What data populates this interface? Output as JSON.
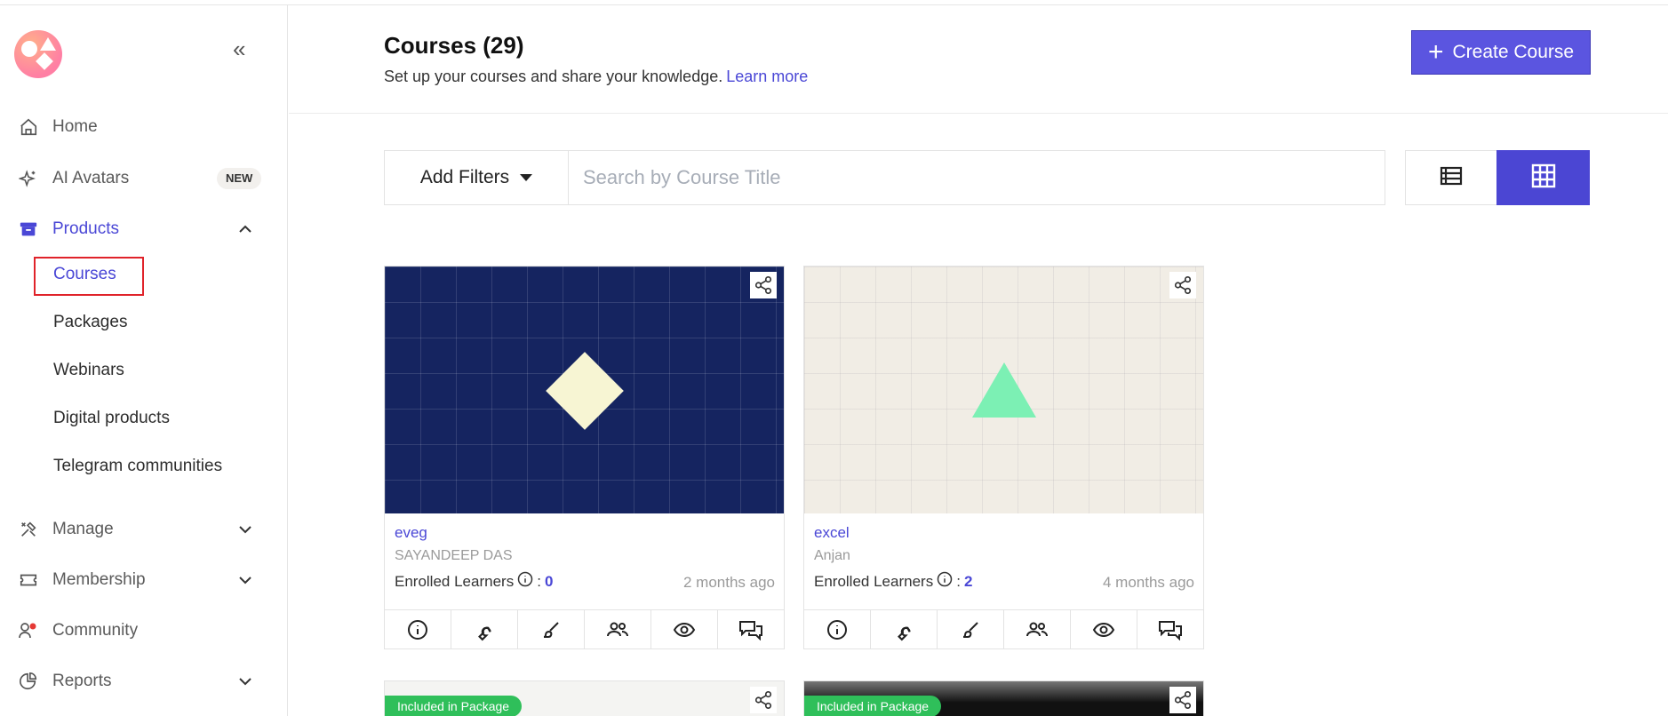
{
  "sidebar": {
    "nav": [
      {
        "label": "Home",
        "icon": "home-icon"
      },
      {
        "label": "AI Avatars",
        "icon": "sparkles-icon",
        "badge": "NEW"
      },
      {
        "label": "Products",
        "icon": "archive-box-icon",
        "expanded": true
      },
      {
        "label": "Manage",
        "icon": "tools-icon"
      },
      {
        "label": "Membership",
        "icon": "ticket-icon"
      },
      {
        "label": "Community",
        "icon": "chat-users-icon"
      },
      {
        "label": "Reports",
        "icon": "pie-chart-icon"
      }
    ],
    "products_sub": [
      "Courses",
      "Packages",
      "Webinars",
      "Digital products",
      "Telegram communities"
    ]
  },
  "header": {
    "title": "Courses (29)",
    "subtitle": "Set up your courses and share your knowledge.",
    "learn_more": "Learn more",
    "create_button": "Create Course"
  },
  "toolbar": {
    "filters_label": "Add Filters",
    "search_placeholder": "Search by Course Title"
  },
  "courses": [
    {
      "title": "eveg",
      "author": "SAYANDEEP DAS",
      "enrolled_label": "Enrolled Learners",
      "enrolled_count": "0",
      "time": "2 months ago"
    },
    {
      "title": "excel",
      "author": "Anjan",
      "enrolled_label": "Enrolled Learners",
      "enrolled_count": "2",
      "time": "4 months ago"
    }
  ],
  "more_courses": [
    {
      "badge": "Included in Package"
    },
    {
      "badge": "Included in Package"
    }
  ],
  "colors": {
    "accent": "#4a47d6",
    "create_btn": "#5b55e0",
    "highlight": "#e0232a",
    "badge_green": "#2fbf5a"
  }
}
